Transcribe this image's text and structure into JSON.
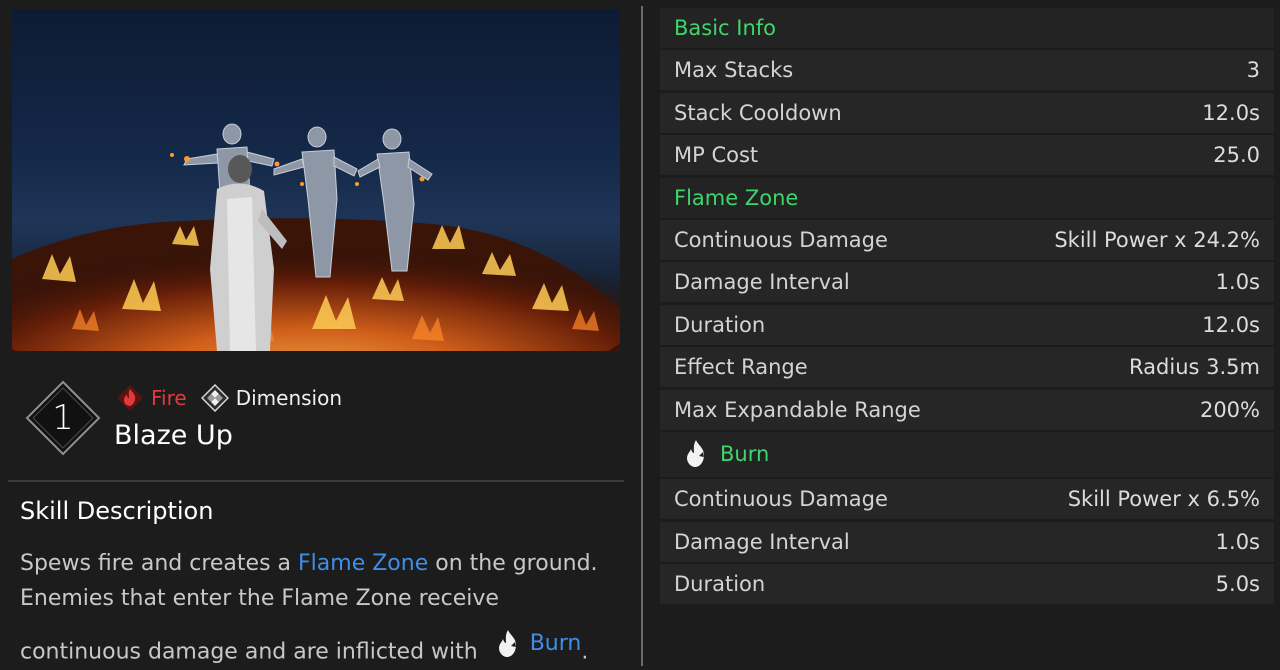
{
  "skill": {
    "number": "1",
    "name": "Blaze Up",
    "tags": [
      {
        "label": "Fire",
        "icon": "fire-element-icon",
        "color": "#e03a3a"
      },
      {
        "label": "Dimension",
        "icon": "dimension-icon",
        "color": "#f0f0f0"
      }
    ]
  },
  "description": {
    "title": "Skill Description",
    "line1_a": "Spews fire and creates a ",
    "line1_link": "Flame Zone",
    "line1_b": " on the ground.",
    "line2": "Enemies that enter the Flame Zone receive",
    "line3_a": "continuous damage and are inflicted with",
    "line3_link": "Burn",
    "line3_b": "."
  },
  "stats": {
    "basic_title": "Basic Info",
    "basic": [
      {
        "label": "Max Stacks",
        "value": "3"
      },
      {
        "label": "Stack Cooldown",
        "value": "12.0s"
      },
      {
        "label": "MP Cost",
        "value": "25.0"
      }
    ],
    "flame_title": "Flame Zone",
    "flame": [
      {
        "label": "Continuous Damage",
        "value": "Skill Power x 24.2%"
      },
      {
        "label": "Damage Interval",
        "value": "1.0s"
      },
      {
        "label": "Duration",
        "value": "12.0s"
      },
      {
        "label": "Effect Range",
        "value": "Radius 3.5m"
      },
      {
        "label": "Max Expandable Range",
        "value": "200%"
      }
    ],
    "burn_title": "Burn",
    "burn": [
      {
        "label": "Continuous Damage",
        "value": "Skill Power x 6.5%"
      },
      {
        "label": "Damage Interval",
        "value": "1.0s"
      },
      {
        "label": "Duration",
        "value": "5.0s"
      }
    ]
  },
  "colors": {
    "section_green": "#3ed66a",
    "link_blue": "#3f8ee8",
    "fire_red": "#e03a3a"
  }
}
